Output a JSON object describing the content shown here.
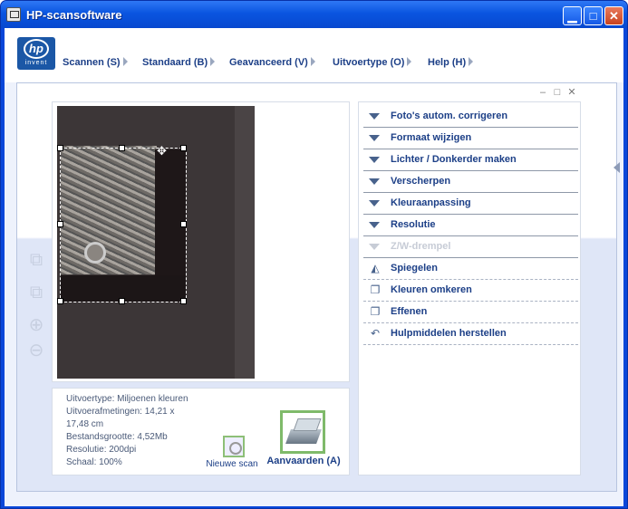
{
  "window": {
    "title": "HP-scansoftware"
  },
  "logo": {
    "text": "hp",
    "subtext": "invent"
  },
  "menu": [
    "Scannen (S)",
    "Standaard (B)",
    "Geavanceerd (V)",
    "Uitvoertype (O)",
    "Help (H)"
  ],
  "info": {
    "output_type": "Uitvoertype: Miljoenen kleuren",
    "dims_line1": "Uitvoerafmetingen: 14,21 x",
    "dims_line2": "17,48 cm",
    "filesize": "Bestandsgrootte: 4,52Mb",
    "resolution": "Resolutie:  200dpi",
    "scale": "Schaal: 100%"
  },
  "actions": {
    "new_scan": "Nieuwe scan",
    "accept": "Aanvaarden (A)"
  },
  "options": [
    {
      "label": "Foto's autom. corrigeren",
      "icon": "triangle-icon"
    },
    {
      "label": "Formaat wijzigen",
      "icon": "triangle-icon"
    },
    {
      "label": "Lichter / Donkerder maken",
      "icon": "triangle-icon"
    },
    {
      "label": "Verscherpen",
      "icon": "triangle-icon"
    },
    {
      "label": "Kleuraanpassing",
      "icon": "triangle-icon"
    },
    {
      "label": "Resolutie",
      "icon": "triangle-icon"
    },
    {
      "label": "Z/W-drempel",
      "icon": "triangle-icon",
      "disabled": true
    },
    {
      "label": "Spiegelen",
      "icon": "mirror-icon"
    },
    {
      "label": "Kleuren omkeren",
      "icon": "invert-icon"
    },
    {
      "label": "Effenen",
      "icon": "smooth-icon"
    },
    {
      "label": "Hulpmiddelen herstellen",
      "icon": "undo-icon"
    }
  ],
  "colors": {
    "titlebar": "#0a55e0",
    "menu_text": "#1c3f87",
    "panel_bg": "#dfe6f7",
    "accept_border": "#7fba6a"
  }
}
